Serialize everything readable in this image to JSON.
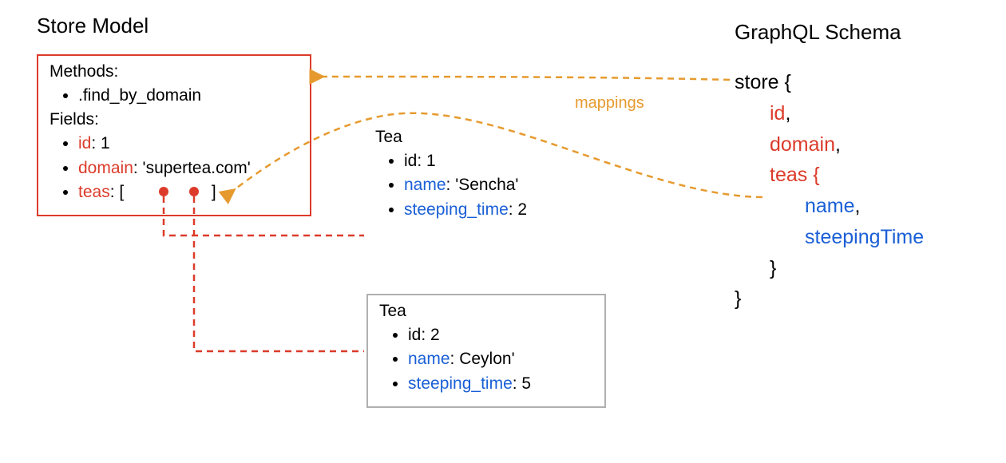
{
  "titles": {
    "storeModel": "Store Model",
    "graphqlSchema": "GraphQL Schema"
  },
  "storeBox": {
    "methodsLabel": "Methods:",
    "method1": ".find_by_domain",
    "fieldsLabel": "Fields:",
    "idKey": "id",
    "idVal": ": 1",
    "domainKey": "domain",
    "domainVal": ": 'supertea.com'",
    "teasKey": "teas",
    "teasOpen": ": [",
    "teasClose": "]"
  },
  "tea1": {
    "title": "Tea",
    "idLine": "id: 1",
    "nameKey": "name",
    "nameVal": ": 'Sencha'",
    "stKey": "steeping_time",
    "stVal": ": 2"
  },
  "tea2": {
    "title": "Tea",
    "idLine": "id: 2",
    "nameKey": "name",
    "nameVal": ": Ceylon'",
    "stKey": "steeping_time",
    "stVal": ": 5"
  },
  "mappingsLabel": "mappings",
  "schema": {
    "storeOpen": "store {",
    "id": "id",
    "domain": "domain",
    "teasOpen": "teas {",
    "name": "name",
    "steepingTime": "steepingTime",
    "closeInner": "}",
    "closeOuter": "}",
    "comma": ","
  }
}
